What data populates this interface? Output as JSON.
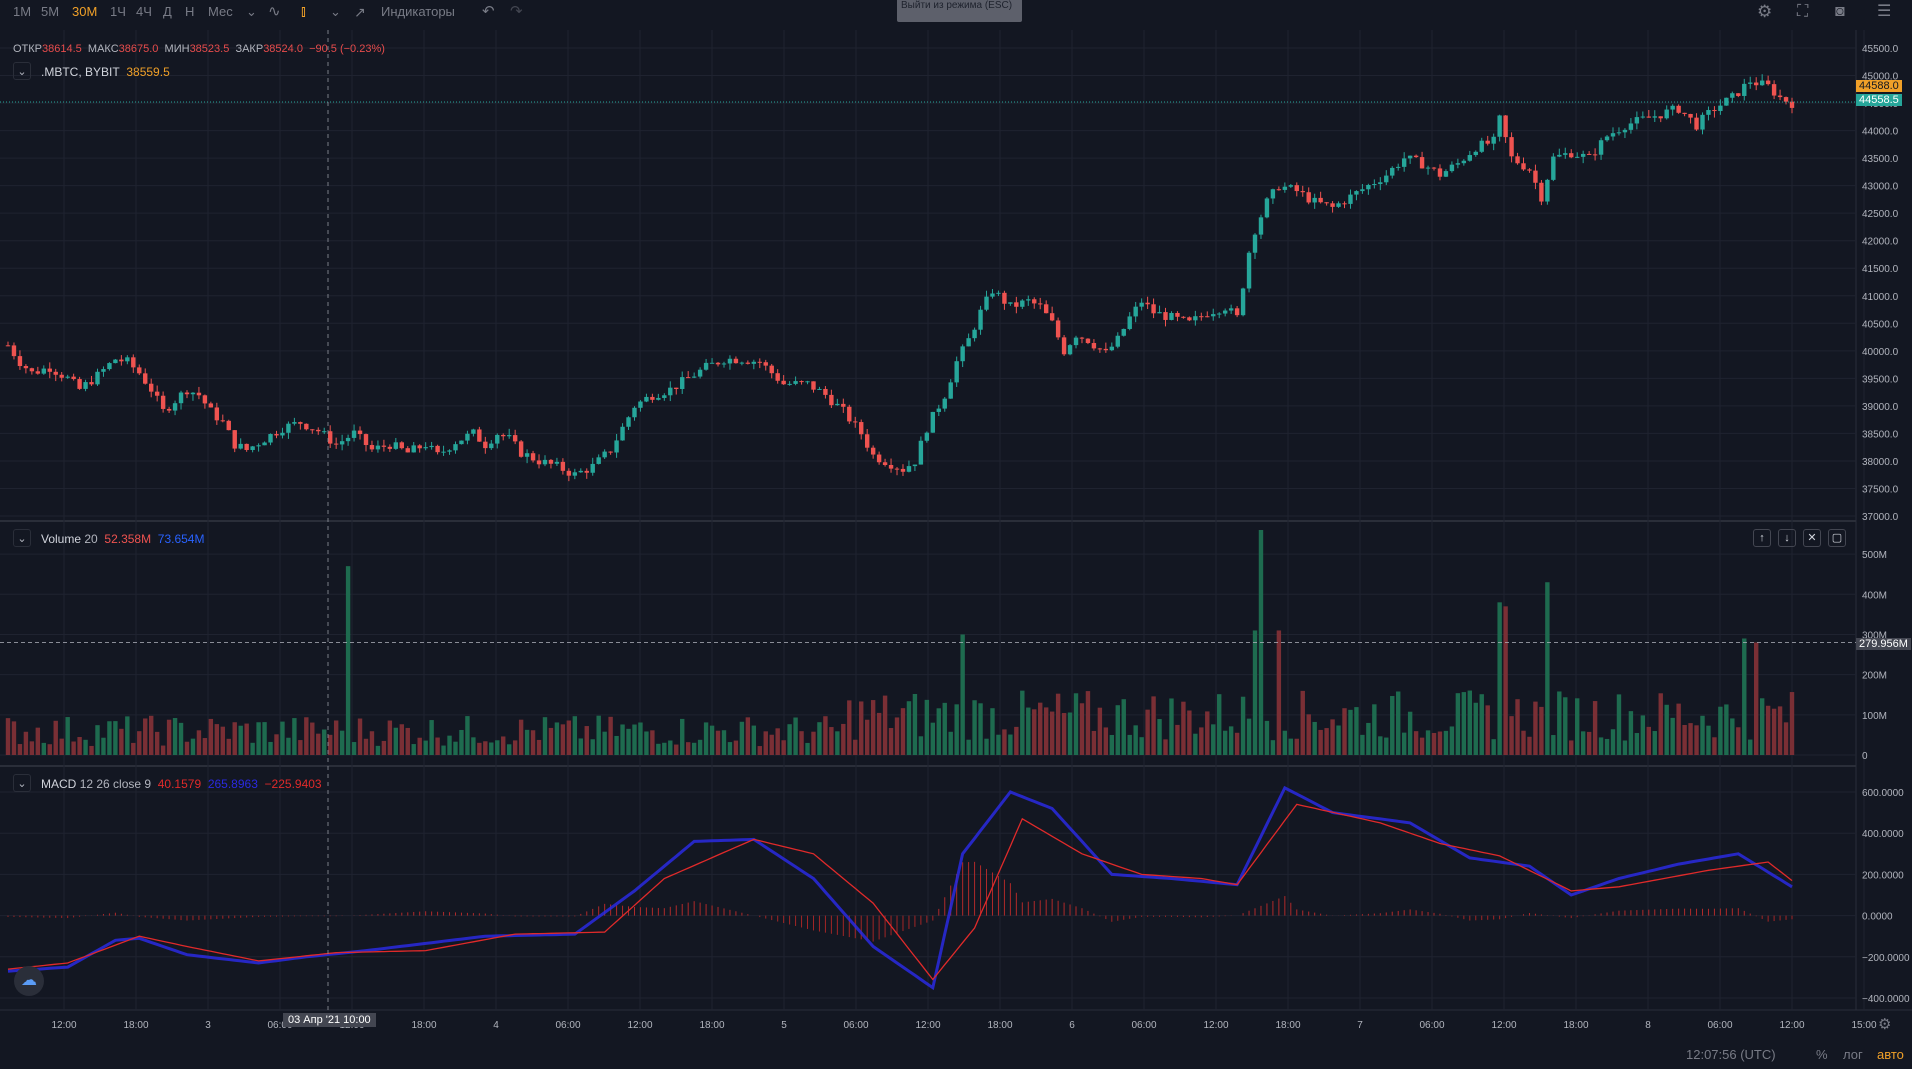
{
  "toolbar": {
    "timeframes": [
      "1М",
      "5М",
      "30М",
      "1Ч",
      "4Ч",
      "Д",
      "Н",
      "Мес"
    ],
    "active_timeframe": "30М",
    "indicators_label": "Индикаторы",
    "exit_fullscreen": "Выйти из режима (ESC)"
  },
  "legend": {
    "open_label": "ОТКР",
    "open": "38614.5",
    "high_label": "МАКС",
    "high": "38675.0",
    "low_label": "МИН",
    "low": "38523.5",
    "close_label": "ЗАКР",
    "close": "38524.0",
    "change": "−90.5 (−0.23%)",
    "symbol": ".MBTC, BYBIT",
    "symbol_value": "38559.5"
  },
  "price_tags": {
    "upper": "44588.0",
    "lower": "44558.5",
    "volume_line": "279.956M"
  },
  "volume_legend": {
    "name": "Volume",
    "param": "20",
    "v1": "52.358M",
    "v2": "73.654M"
  },
  "macd_legend": {
    "name": "MACD",
    "params": "12 26 close 9",
    "v1": "40.1579",
    "v2": "265.8963",
    "v3": "−225.9403"
  },
  "crosshair_label": "03 Апр '21   10:00",
  "status_bar": {
    "time": "12:07:56 (UTC)",
    "percent": "%",
    "log": "лог",
    "auto": "авто"
  },
  "colors": {
    "up": "#26a69a",
    "down": "#ef5350",
    "macd": "#2a2ae0",
    "signal": "#e02a2a",
    "bg": "#131722"
  },
  "chart_data": [
    {
      "type": "candlestick",
      "title": ".MBTC, BYBIT",
      "x_tick_labels": [
        "12:00",
        "18:00",
        "3",
        "06:00",
        "12:00",
        "18:00",
        "4",
        "06:00",
        "12:00",
        "18:00",
        "5",
        "06:00",
        "12:00",
        "18:00",
        "6",
        "06:00",
        "12:00",
        "18:00",
        "7",
        "06:00",
        "12:00",
        "18:00",
        "8",
        "06:00",
        "12:00",
        "15:00"
      ],
      "ylim": [
        37000,
        45500
      ],
      "y_tick_labels": [
        "45500.0",
        "45000.0",
        "44500.0",
        "44000.0",
        "43500.0",
        "43000.0",
        "42500.0",
        "42000.0",
        "41500.0",
        "41000.0",
        "40500.0",
        "40000.0",
        "39500.0",
        "39000.0",
        "38500.0",
        "38000.0",
        "37500.0",
        "37000.0"
      ],
      "close_path": [
        [
          0,
          40100
        ],
        [
          2,
          39800
        ],
        [
          4,
          39600
        ],
        [
          7,
          39700
        ],
        [
          10,
          39500
        ],
        [
          12,
          39300
        ],
        [
          15,
          39550
        ],
        [
          18,
          39850
        ],
        [
          20,
          39800
        ],
        [
          22,
          39600
        ],
        [
          24,
          39300
        ],
        [
          26,
          38900
        ],
        [
          28,
          39100
        ],
        [
          30,
          39300
        ],
        [
          32,
          39200
        ],
        [
          34,
          38900
        ],
        [
          36,
          38700
        ],
        [
          38,
          38300
        ],
        [
          40,
          38200
        ],
        [
          43,
          38400
        ],
        [
          46,
          38600
        ],
        [
          49,
          38700
        ],
        [
          52,
          38550
        ],
        [
          55,
          38300
        ],
        [
          58,
          38500
        ],
        [
          61,
          38200
        ],
        [
          64,
          38300
        ],
        [
          67,
          38150
        ],
        [
          70,
          38300
        ],
        [
          72,
          38100
        ],
        [
          75,
          38350
        ],
        [
          78,
          38500
        ],
        [
          80,
          38300
        ],
        [
          82,
          38500
        ],
        [
          84,
          38400
        ],
        [
          86,
          38150
        ],
        [
          89,
          38000
        ],
        [
          92,
          37900
        ],
        [
          95,
          37750
        ],
        [
          98,
          37900
        ],
        [
          101,
          38200
        ],
        [
          103,
          38600
        ],
        [
          105,
          39000
        ],
        [
          108,
          39200
        ],
        [
          111,
          39300
        ],
        [
          114,
          39500
        ],
        [
          117,
          39700
        ],
        [
          120,
          39850
        ],
        [
          123,
          39850
        ],
        [
          126,
          39800
        ],
        [
          128,
          39600
        ],
        [
          130,
          39400
        ],
        [
          134,
          39400
        ],
        [
          137,
          39200
        ],
        [
          140,
          38900
        ],
        [
          143,
          38500
        ],
        [
          145,
          38100
        ],
        [
          148,
          37950
        ],
        [
          150,
          37850
        ],
        [
          152,
          38000
        ],
        [
          154,
          38600
        ],
        [
          157,
          39200
        ],
        [
          159,
          39800
        ],
        [
          161,
          40200
        ],
        [
          163,
          40700
        ],
        [
          165,
          41100
        ],
        [
          168,
          40800
        ],
        [
          171,
          40900
        ],
        [
          173,
          40800
        ],
        [
          175,
          40500
        ],
        [
          177,
          40000
        ],
        [
          179,
          40300
        ],
        [
          181,
          40200
        ],
        [
          184,
          39950
        ],
        [
          186,
          40200
        ],
        [
          188,
          40600
        ],
        [
          190,
          40900
        ],
        [
          192,
          40700
        ],
        [
          195,
          40600
        ],
        [
          198,
          40500
        ],
        [
          201,
          40700
        ],
        [
          204,
          40800
        ],
        [
          206,
          40600
        ],
        [
          207,
          41200
        ],
        [
          208,
          41800
        ],
        [
          209,
          42200
        ],
        [
          211,
          42700
        ],
        [
          213,
          43000
        ],
        [
          216,
          42900
        ],
        [
          219,
          42700
        ],
        [
          222,
          42600
        ],
        [
          225,
          42800
        ],
        [
          228,
          43000
        ],
        [
          231,
          43200
        ],
        [
          234,
          43500
        ],
        [
          237,
          43400
        ],
        [
          240,
          43200
        ],
        [
          243,
          43400
        ],
        [
          246,
          43700
        ],
        [
          249,
          43800
        ],
        [
          250,
          44200
        ],
        [
          252,
          43500
        ],
        [
          255,
          43300
        ],
        [
          257,
          42800
        ],
        [
          259,
          43500
        ],
        [
          262,
          43600
        ],
        [
          265,
          43500
        ],
        [
          268,
          43900
        ],
        [
          271,
          44100
        ],
        [
          274,
          44200
        ],
        [
          277,
          44300
        ],
        [
          280,
          44400
        ],
        [
          283,
          44100
        ],
        [
          286,
          44400
        ],
        [
          289,
          44600
        ],
        [
          292,
          44900
        ],
        [
          295,
          44800
        ],
        [
          297,
          44600
        ],
        [
          299,
          44500
        ]
      ],
      "volume_ylim": [
        0,
        560
      ],
      "volume_unit": "M",
      "volume_y_tick_labels": [
        "500M",
        "400M",
        "300M",
        "200M",
        "100M",
        "0"
      ],
      "volume_spikes": [
        [
          57,
          470
        ],
        [
          160,
          300
        ],
        [
          209,
          310
        ],
        [
          210,
          560
        ],
        [
          213,
          310
        ],
        [
          250,
          380
        ],
        [
          251,
          370
        ],
        [
          258,
          430
        ],
        [
          291,
          290
        ],
        [
          293,
          280
        ]
      ],
      "macd_ylim": [
        -400,
        600
      ],
      "macd_y_tick_labels": [
        "600.0000",
        "400.0000",
        "200.0000",
        "0.0000",
        "−200.0000",
        "−400.0000"
      ],
      "macd_path": [
        [
          0,
          -270
        ],
        [
          10,
          -250
        ],
        [
          18,
          -120
        ],
        [
          22,
          -110
        ],
        [
          30,
          -190
        ],
        [
          42,
          -230
        ],
        [
          50,
          -200
        ],
        [
          60,
          -170
        ],
        [
          80,
          -100
        ],
        [
          95,
          -90
        ],
        [
          105,
          120
        ],
        [
          115,
          360
        ],
        [
          125,
          370
        ],
        [
          135,
          180
        ],
        [
          145,
          -150
        ],
        [
          155,
          -350
        ],
        [
          160,
          300
        ],
        [
          168,
          600
        ],
        [
          175,
          520
        ],
        [
          185,
          200
        ],
        [
          195,
          180
        ],
        [
          206,
          150
        ],
        [
          214,
          620
        ],
        [
          222,
          500
        ],
        [
          235,
          450
        ],
        [
          245,
          280
        ],
        [
          255,
          240
        ],
        [
          262,
          100
        ],
        [
          270,
          180
        ],
        [
          280,
          250
        ],
        [
          290,
          300
        ],
        [
          299,
          140
        ]
      ],
      "signal_path": [
        [
          0,
          -260
        ],
        [
          10,
          -230
        ],
        [
          22,
          -100
        ],
        [
          30,
          -150
        ],
        [
          42,
          -220
        ],
        [
          55,
          -180
        ],
        [
          70,
          -170
        ],
        [
          85,
          -90
        ],
        [
          100,
          -80
        ],
        [
          110,
          180
        ],
        [
          125,
          370
        ],
        [
          135,
          300
        ],
        [
          145,
          60
        ],
        [
          155,
          -310
        ],
        [
          162,
          -60
        ],
        [
          170,
          470
        ],
        [
          180,
          300
        ],
        [
          190,
          200
        ],
        [
          200,
          180
        ],
        [
          206,
          150
        ],
        [
          216,
          540
        ],
        [
          230,
          450
        ],
        [
          240,
          350
        ],
        [
          250,
          290
        ],
        [
          262,
          120
        ],
        [
          270,
          140
        ],
        [
          285,
          220
        ],
        [
          295,
          260
        ],
        [
          299,
          170
        ]
      ]
    }
  ]
}
